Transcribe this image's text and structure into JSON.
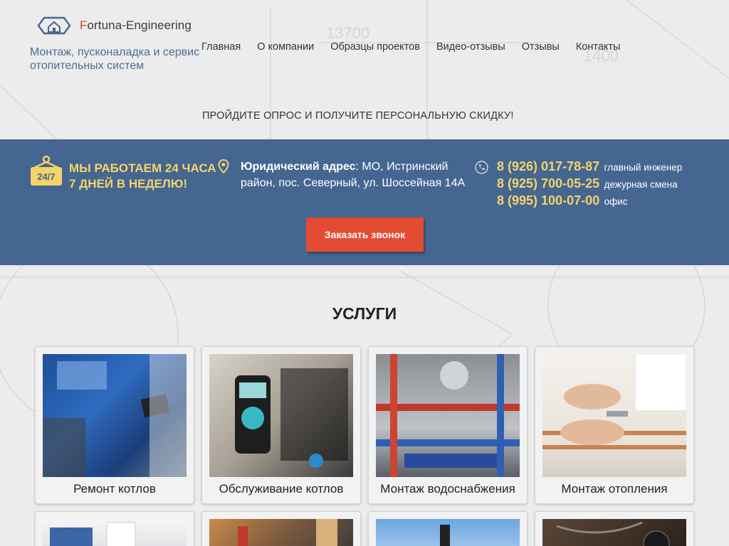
{
  "brand": {
    "logo_first_letter": "F",
    "logo_rest": "ortuna-Engineering",
    "tagline": "Монтаж, пусконаладка и сервис отопительных систем"
  },
  "nav": [
    {
      "label": "Главная"
    },
    {
      "label": "О компании"
    },
    {
      "label": "Образцы проектов"
    },
    {
      "label": "Видео-отзывы"
    },
    {
      "label": "Отзывы"
    },
    {
      "label": "Контакты"
    }
  ],
  "promo_text": "ПРОЙДИТЕ ОПРОС И ПОЛУЧИТЕ ПЕРСОНАЛЬНУЮ СКИДКУ!",
  "band": {
    "badge_text": "24/7",
    "hours_line1": "МЫ РАБОТАЕМ 24 ЧАСА",
    "hours_line2": "7 ДНЕЙ В НЕДЕЛЮ!",
    "address_label": "Юридический адрес",
    "address_text": ": МО, Истринский район, пос. Северный, ул. Шоссейная 14А",
    "phones": [
      {
        "number": "8 (926) 017-78-87",
        "note": "главный инженер"
      },
      {
        "number": "8 (925) 700-05-25",
        "note": "дежурная смена"
      },
      {
        "number": "8 (995) 100-07-00",
        "note": "офис"
      }
    ],
    "cta_label": "Заказать звонок"
  },
  "services": {
    "title": "УСЛУГИ",
    "items": [
      {
        "label": "Ремонт котлов"
      },
      {
        "label": "Обслуживание котлов"
      },
      {
        "label": "Монтаж водоснабжения"
      },
      {
        "label": "Монтаж отопления"
      }
    ]
  },
  "colors": {
    "band": "#456690",
    "accent_yellow": "#f4d36a",
    "cta": "#e34b33",
    "tagline": "#4a6d95"
  },
  "background_numbers": [
    "13700",
    "1400"
  ]
}
